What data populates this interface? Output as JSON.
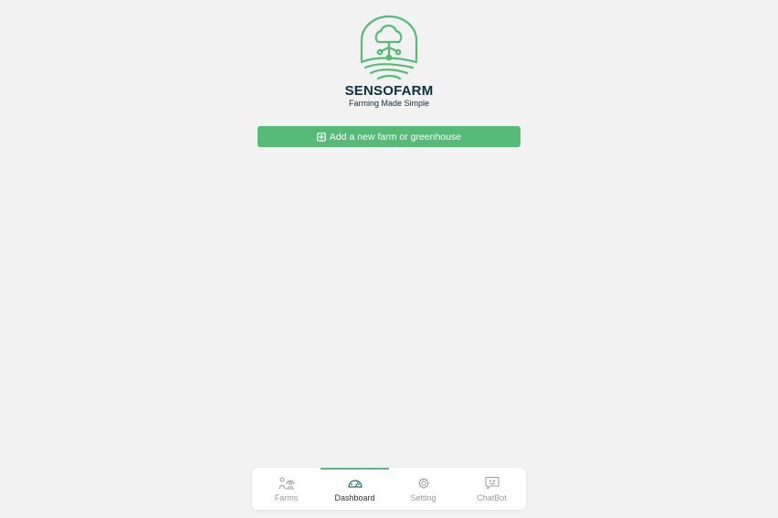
{
  "brand": {
    "name": "SENSOFARM",
    "tagline": "Farming Made Simple"
  },
  "actions": {
    "add_farm_label": "Add a new farm or greenhouse"
  },
  "nav": {
    "items": [
      {
        "label": "Farms",
        "icon": "farm-icon"
      },
      {
        "label": "Dashboard",
        "icon": "gauge-icon",
        "active": true
      },
      {
        "label": "Setting",
        "icon": "gear-icon"
      },
      {
        "label": "ChatBot",
        "icon": "chat-icon"
      }
    ]
  },
  "colors": {
    "accent": "#55bb77",
    "brand_text": "#0f2f3f",
    "background": "#f2f2f2"
  }
}
